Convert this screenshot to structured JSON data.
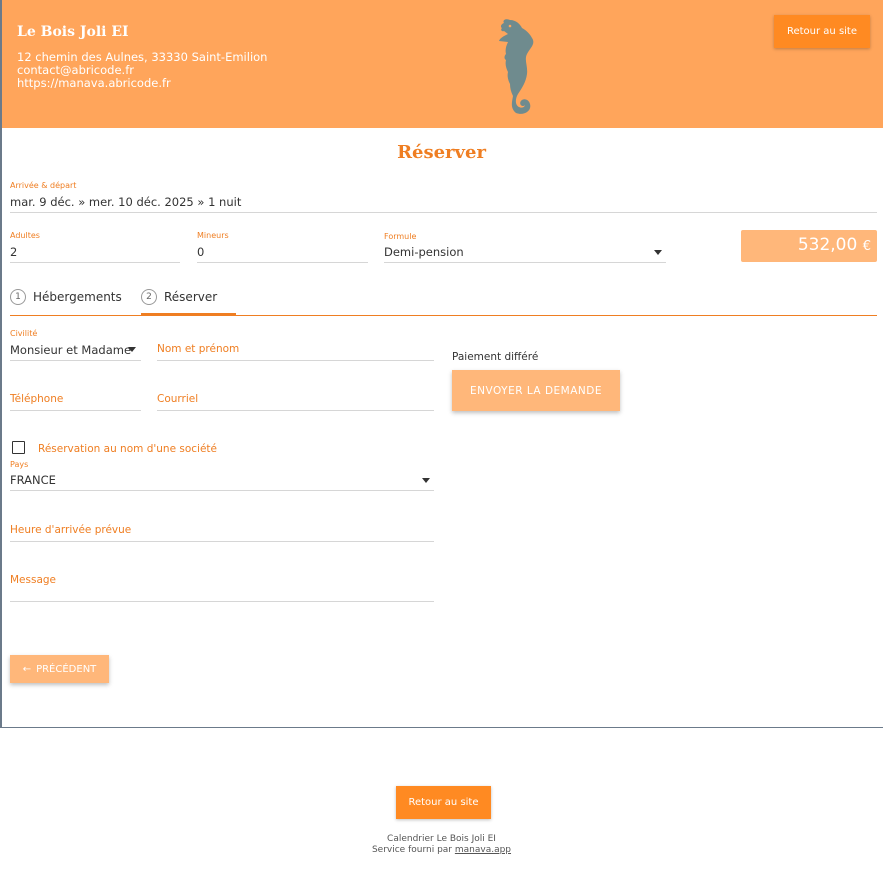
{
  "header": {
    "business_name": "Le Bois Joli EI",
    "address": "12 chemin des Aulnes, 33330 Saint-Emilion",
    "email": "contact@abricode.fr",
    "website": "https://manava.abricode.fr",
    "logo_icon": "seahorse-icon",
    "back_label": "Retour au site"
  },
  "page": {
    "title": "Réserver"
  },
  "stay": {
    "dates_label": "Arrivée & départ",
    "dates_value": "mar. 9 déc. » mer. 10 déc. 2025 » 1 nuit",
    "adults_label": "Adultes",
    "adults_value": "2",
    "minors_label": "Mineurs",
    "minors_value": "0",
    "formula_label": "Formule",
    "formula_value": "Demi-pension",
    "price_amount": "532,00",
    "price_currency": "€"
  },
  "steps": [
    {
      "num": "1",
      "label": "Hébergements"
    },
    {
      "num": "2",
      "label": "Réserver"
    }
  ],
  "form": {
    "civility_label": "Civilité",
    "civility_value": "Monsieur et Madame",
    "name_placeholder": "Nom et prénom",
    "phone_placeholder": "Téléphone",
    "email_placeholder": "Courriel",
    "company_checkbox_label": "Réservation au nom d'une société",
    "country_label": "Pays",
    "country_value": "FRANCE",
    "arrival_time_placeholder": "Heure d'arrivée prévue",
    "message_placeholder": "Message",
    "prev_label": "PRÉCÉDENT"
  },
  "payment": {
    "label": "Paiement différé",
    "send_label": "ENVOYER LA DEMANDE"
  },
  "footer": {
    "back_label": "Retour au site",
    "calendar_text": "Calendrier Le Bois Joli EI",
    "service_text": "Service fourni par",
    "service_link": "manava.app"
  },
  "colors": {
    "header_bg": "#ffa55b",
    "accent": "#ef7e22",
    "button_bg": "#ff8a22",
    "button_light": "#ffb77a"
  }
}
